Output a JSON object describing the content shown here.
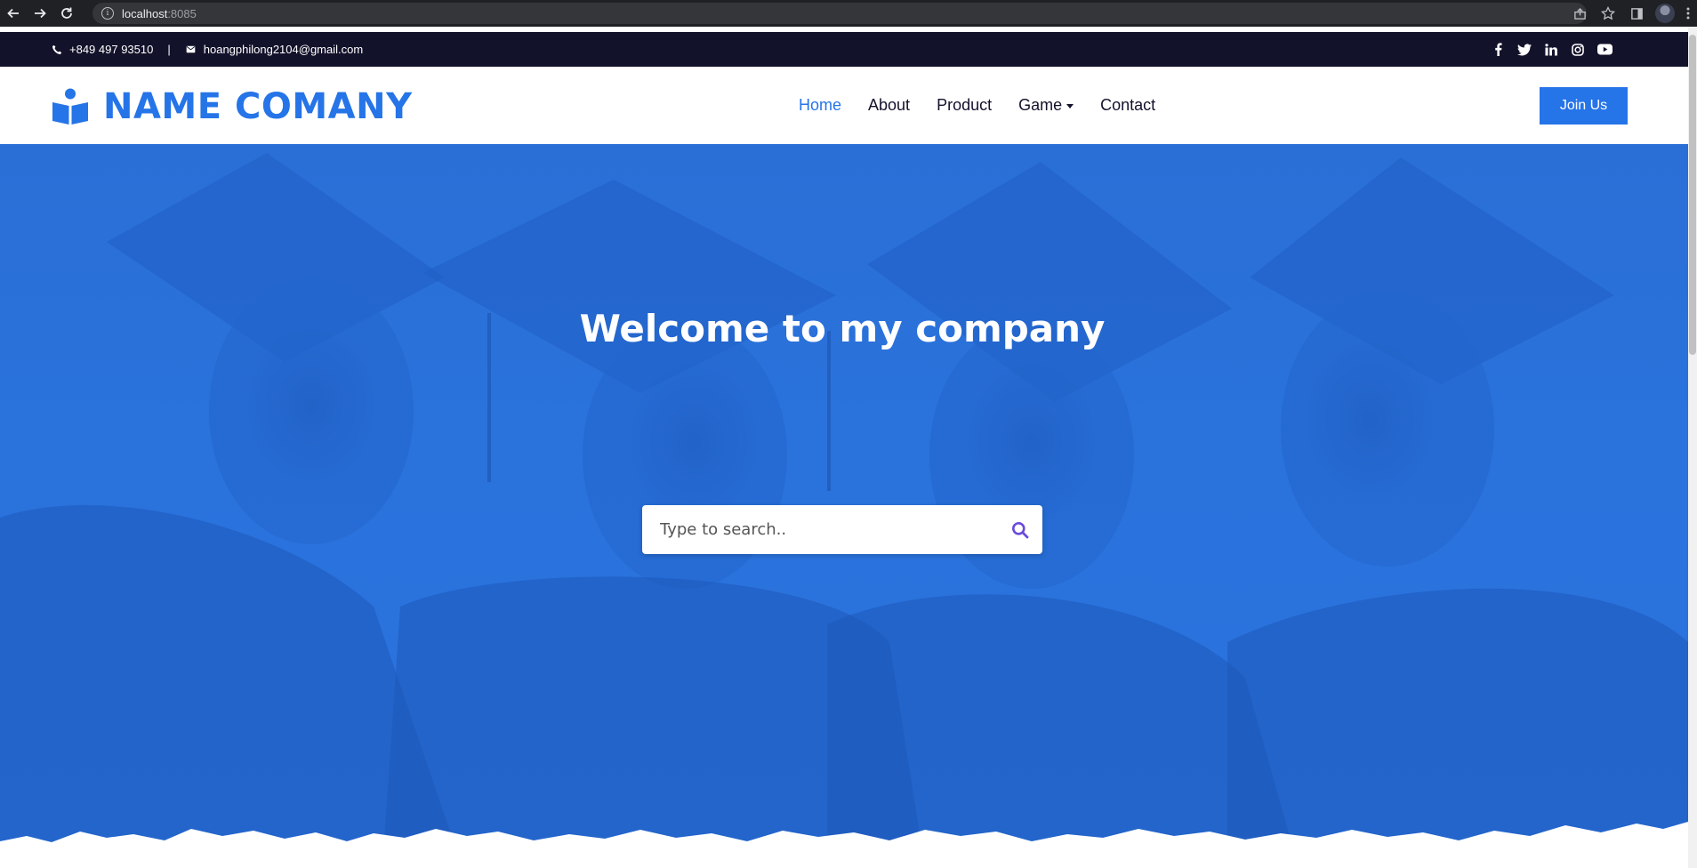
{
  "browser": {
    "url_host": "localhost",
    "url_port": ":8085"
  },
  "topbar": {
    "phone": "+849 497 93510",
    "separator": "|",
    "email": "hoangphilong2104@gmail.com",
    "social": [
      "facebook-icon",
      "twitter-icon",
      "linkedin-icon",
      "instagram-icon",
      "youtube-icon"
    ]
  },
  "brand": {
    "name": "NAME COMANY"
  },
  "nav": {
    "items": [
      {
        "label": "Home",
        "active": true
      },
      {
        "label": "About"
      },
      {
        "label": "Product"
      },
      {
        "label": "Game",
        "dropdown": true
      },
      {
        "label": "Contact"
      }
    ],
    "join_label": "Join Us"
  },
  "hero": {
    "title": "Welcome to my company",
    "search_placeholder": "Type to search.."
  },
  "colors": {
    "accent": "#2574e8",
    "dark": "#13122b",
    "hero_overlay": "#2a72dc",
    "search_icon": "#6a4bdc"
  }
}
